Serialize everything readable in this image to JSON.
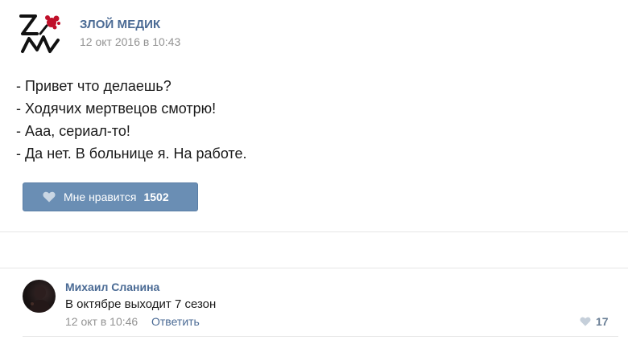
{
  "post": {
    "author": "ЗЛОЙ МЕДИК",
    "date": "12 окт 2016 в 10:43",
    "lines": [
      "- Привет что делаешь?",
      "- Ходячих мертвецов смотрю!",
      "- Ааа, сериал-то!",
      "- Да нет. В больнице я. На работе."
    ],
    "like_label": "Мне нравится",
    "like_count": "1502"
  },
  "comment": {
    "author": "Михаил Сланина",
    "text": "В октябре выходит 7 сезон",
    "date": "12 окт в 10:46",
    "reply_label": "Ответить",
    "like_count": "17"
  },
  "colors": {
    "link": "#4a6a94",
    "like_button": "#6a8eb4",
    "muted": "#939393",
    "logo_accent": "#c0102a"
  },
  "icons": {
    "logo": "zm-logo",
    "like": "heart-icon",
    "comment_like": "heart-icon"
  }
}
